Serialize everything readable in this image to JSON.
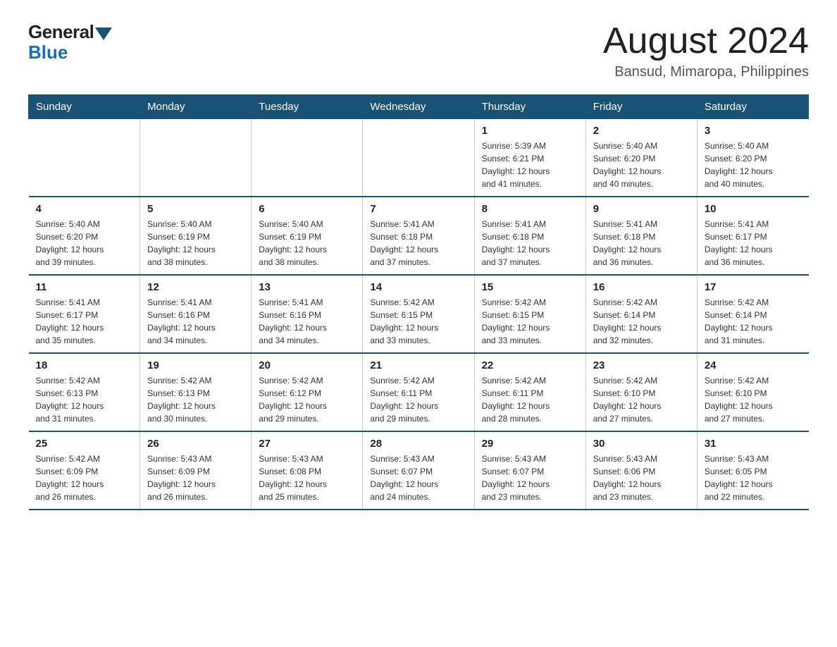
{
  "logo": {
    "general": "General",
    "blue": "Blue"
  },
  "title": {
    "month_year": "August 2024",
    "location": "Bansud, Mimaropa, Philippines"
  },
  "days_of_week": [
    "Sunday",
    "Monday",
    "Tuesday",
    "Wednesday",
    "Thursday",
    "Friday",
    "Saturday"
  ],
  "weeks": [
    [
      {
        "day": "",
        "info": ""
      },
      {
        "day": "",
        "info": ""
      },
      {
        "day": "",
        "info": ""
      },
      {
        "day": "",
        "info": ""
      },
      {
        "day": "1",
        "info": "Sunrise: 5:39 AM\nSunset: 6:21 PM\nDaylight: 12 hours\nand 41 minutes."
      },
      {
        "day": "2",
        "info": "Sunrise: 5:40 AM\nSunset: 6:20 PM\nDaylight: 12 hours\nand 40 minutes."
      },
      {
        "day": "3",
        "info": "Sunrise: 5:40 AM\nSunset: 6:20 PM\nDaylight: 12 hours\nand 40 minutes."
      }
    ],
    [
      {
        "day": "4",
        "info": "Sunrise: 5:40 AM\nSunset: 6:20 PM\nDaylight: 12 hours\nand 39 minutes."
      },
      {
        "day": "5",
        "info": "Sunrise: 5:40 AM\nSunset: 6:19 PM\nDaylight: 12 hours\nand 38 minutes."
      },
      {
        "day": "6",
        "info": "Sunrise: 5:40 AM\nSunset: 6:19 PM\nDaylight: 12 hours\nand 38 minutes."
      },
      {
        "day": "7",
        "info": "Sunrise: 5:41 AM\nSunset: 6:18 PM\nDaylight: 12 hours\nand 37 minutes."
      },
      {
        "day": "8",
        "info": "Sunrise: 5:41 AM\nSunset: 6:18 PM\nDaylight: 12 hours\nand 37 minutes."
      },
      {
        "day": "9",
        "info": "Sunrise: 5:41 AM\nSunset: 6:18 PM\nDaylight: 12 hours\nand 36 minutes."
      },
      {
        "day": "10",
        "info": "Sunrise: 5:41 AM\nSunset: 6:17 PM\nDaylight: 12 hours\nand 36 minutes."
      }
    ],
    [
      {
        "day": "11",
        "info": "Sunrise: 5:41 AM\nSunset: 6:17 PM\nDaylight: 12 hours\nand 35 minutes."
      },
      {
        "day": "12",
        "info": "Sunrise: 5:41 AM\nSunset: 6:16 PM\nDaylight: 12 hours\nand 34 minutes."
      },
      {
        "day": "13",
        "info": "Sunrise: 5:41 AM\nSunset: 6:16 PM\nDaylight: 12 hours\nand 34 minutes."
      },
      {
        "day": "14",
        "info": "Sunrise: 5:42 AM\nSunset: 6:15 PM\nDaylight: 12 hours\nand 33 minutes."
      },
      {
        "day": "15",
        "info": "Sunrise: 5:42 AM\nSunset: 6:15 PM\nDaylight: 12 hours\nand 33 minutes."
      },
      {
        "day": "16",
        "info": "Sunrise: 5:42 AM\nSunset: 6:14 PM\nDaylight: 12 hours\nand 32 minutes."
      },
      {
        "day": "17",
        "info": "Sunrise: 5:42 AM\nSunset: 6:14 PM\nDaylight: 12 hours\nand 31 minutes."
      }
    ],
    [
      {
        "day": "18",
        "info": "Sunrise: 5:42 AM\nSunset: 6:13 PM\nDaylight: 12 hours\nand 31 minutes."
      },
      {
        "day": "19",
        "info": "Sunrise: 5:42 AM\nSunset: 6:13 PM\nDaylight: 12 hours\nand 30 minutes."
      },
      {
        "day": "20",
        "info": "Sunrise: 5:42 AM\nSunset: 6:12 PM\nDaylight: 12 hours\nand 29 minutes."
      },
      {
        "day": "21",
        "info": "Sunrise: 5:42 AM\nSunset: 6:11 PM\nDaylight: 12 hours\nand 29 minutes."
      },
      {
        "day": "22",
        "info": "Sunrise: 5:42 AM\nSunset: 6:11 PM\nDaylight: 12 hours\nand 28 minutes."
      },
      {
        "day": "23",
        "info": "Sunrise: 5:42 AM\nSunset: 6:10 PM\nDaylight: 12 hours\nand 27 minutes."
      },
      {
        "day": "24",
        "info": "Sunrise: 5:42 AM\nSunset: 6:10 PM\nDaylight: 12 hours\nand 27 minutes."
      }
    ],
    [
      {
        "day": "25",
        "info": "Sunrise: 5:42 AM\nSunset: 6:09 PM\nDaylight: 12 hours\nand 26 minutes."
      },
      {
        "day": "26",
        "info": "Sunrise: 5:43 AM\nSunset: 6:09 PM\nDaylight: 12 hours\nand 26 minutes."
      },
      {
        "day": "27",
        "info": "Sunrise: 5:43 AM\nSunset: 6:08 PM\nDaylight: 12 hours\nand 25 minutes."
      },
      {
        "day": "28",
        "info": "Sunrise: 5:43 AM\nSunset: 6:07 PM\nDaylight: 12 hours\nand 24 minutes."
      },
      {
        "day": "29",
        "info": "Sunrise: 5:43 AM\nSunset: 6:07 PM\nDaylight: 12 hours\nand 23 minutes."
      },
      {
        "day": "30",
        "info": "Sunrise: 5:43 AM\nSunset: 6:06 PM\nDaylight: 12 hours\nand 23 minutes."
      },
      {
        "day": "31",
        "info": "Sunrise: 5:43 AM\nSunset: 6:05 PM\nDaylight: 12 hours\nand 22 minutes."
      }
    ]
  ]
}
